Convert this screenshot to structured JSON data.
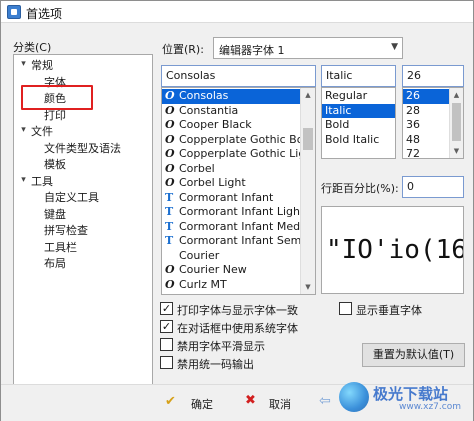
{
  "window": {
    "title": "首选项"
  },
  "category": {
    "label": "分类(C)",
    "tree": [
      {
        "label": "常规",
        "level": 0,
        "expanded": true
      },
      {
        "label": "字体",
        "level": 1
      },
      {
        "label": "颜色",
        "level": 1
      },
      {
        "label": "打印",
        "level": 1
      },
      {
        "label": "文件",
        "level": 0,
        "expanded": true
      },
      {
        "label": "文件类型及语法",
        "level": 1
      },
      {
        "label": "模板",
        "level": 1
      },
      {
        "label": "工具",
        "level": 0,
        "expanded": true
      },
      {
        "label": "自定义工具",
        "level": 1
      },
      {
        "label": "键盘",
        "level": 1
      },
      {
        "label": "拼写检查",
        "level": 1
      },
      {
        "label": "工具栏",
        "level": 1
      },
      {
        "label": "布局",
        "level": 1
      }
    ]
  },
  "location": {
    "label": "位置(R):",
    "value": "编辑器字体 1"
  },
  "font": {
    "name_value": "Consolas",
    "style_value": "Italic",
    "size_value": "26",
    "names": [
      {
        "name": "Consolas",
        "icon": "O",
        "selected": true
      },
      {
        "name": "Constantia",
        "icon": "O"
      },
      {
        "name": "Cooper Black",
        "icon": "O"
      },
      {
        "name": "Copperplate Gothic Bold",
        "icon": "O"
      },
      {
        "name": "Copperplate Gothic Light",
        "icon": "O"
      },
      {
        "name": "Corbel",
        "icon": "O"
      },
      {
        "name": "Corbel Light",
        "icon": "O"
      },
      {
        "name": "Cormorant Infant",
        "icon": "T"
      },
      {
        "name": "Cormorant Infant Light",
        "icon": "T"
      },
      {
        "name": "Cormorant Infant Medium",
        "icon": "T"
      },
      {
        "name": "Cormorant Infant SemiBold",
        "icon": "T"
      },
      {
        "name": "Courier",
        "icon": ""
      },
      {
        "name": "Courier New",
        "icon": "O"
      },
      {
        "name": "Curlz MT",
        "icon": "O"
      }
    ],
    "styles": [
      {
        "name": "Regular"
      },
      {
        "name": "Italic",
        "selected": true
      },
      {
        "name": "Bold"
      },
      {
        "name": "Bold Italic"
      }
    ],
    "sizes": [
      {
        "name": "26",
        "selected": true
      },
      {
        "name": "28"
      },
      {
        "name": "36"
      },
      {
        "name": "48"
      },
      {
        "name": "72"
      }
    ]
  },
  "line_spacing": {
    "label": "行距百分比(%):",
    "value": "0"
  },
  "preview": {
    "text": "\"IO'io(16"
  },
  "options": {
    "print_same": {
      "label": "打印字体与显示字体一致",
      "checked": true
    },
    "system_font": {
      "label": "在对话框中使用系统字体",
      "checked": true
    },
    "no_smooth": {
      "label": "禁用字体平滑显示",
      "checked": false
    },
    "unified_output": {
      "label": "禁用统一码输出",
      "checked": false
    },
    "vertical": {
      "label": "显示垂直字体",
      "checked": false
    }
  },
  "buttons": {
    "reset": "重置为默认值(T)",
    "ok": "确定",
    "cancel": "取消",
    "apply_arrow": "⇦"
  },
  "watermark": {
    "name": "极光下载站",
    "url": "www.xz7.com"
  },
  "colors": {
    "selection": "#0a64d8",
    "highlight_box": "#e02020"
  }
}
